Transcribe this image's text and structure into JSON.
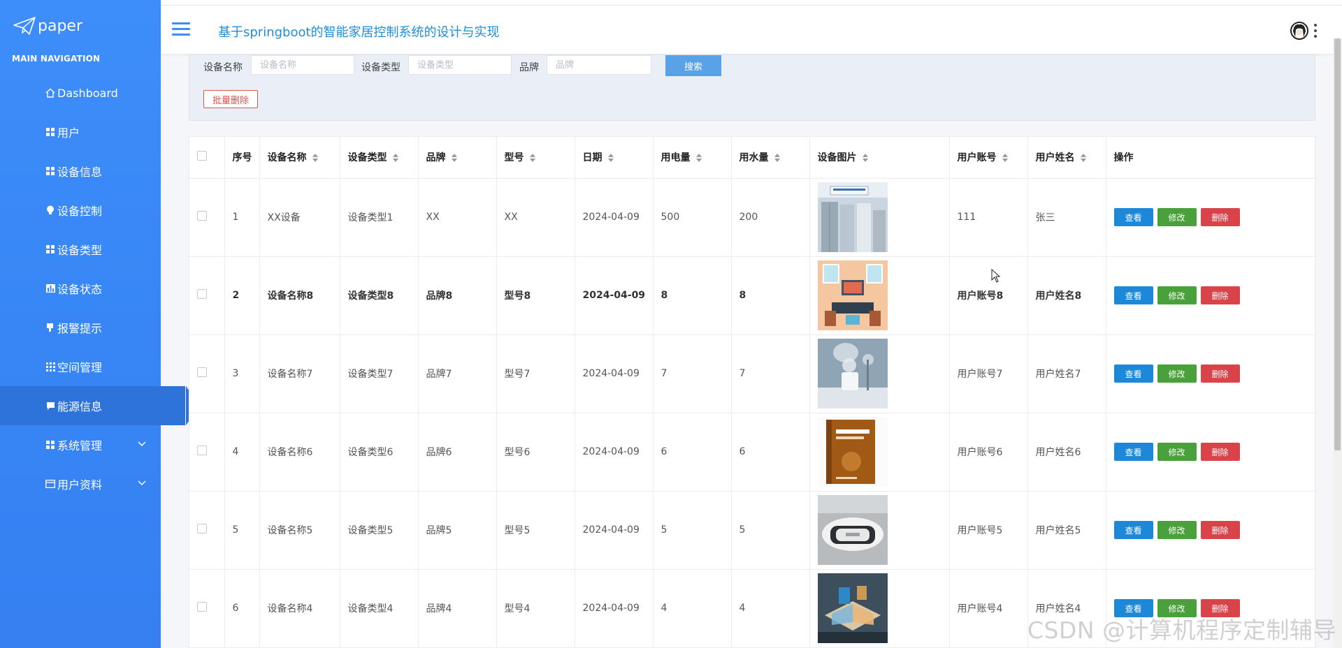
{
  "sidebar": {
    "logo_text": "paper",
    "nav_title": "MAIN NAVIGATION",
    "items": [
      {
        "label": "Dashboard",
        "icon": "home-icon"
      },
      {
        "label": "用户",
        "icon": "grid-icon"
      },
      {
        "label": "设备信息",
        "icon": "grid-icon"
      },
      {
        "label": "设备控制",
        "icon": "bulb-icon"
      },
      {
        "label": "设备类型",
        "icon": "grid-icon"
      },
      {
        "label": "设备状态",
        "icon": "chart-icon"
      },
      {
        "label": "报警提示",
        "icon": "beer-icon"
      },
      {
        "label": "空间管理",
        "icon": "grid9-icon"
      },
      {
        "label": "能源信息",
        "icon": "comment-icon",
        "active": true
      },
      {
        "label": "系统管理",
        "icon": "grid-icon",
        "expandable": true
      },
      {
        "label": "用户资料",
        "icon": "card-icon",
        "expandable": true
      }
    ]
  },
  "header": {
    "title": "基于springboot的智能家居控制系统的设计与实现"
  },
  "search": {
    "name_label": "设备名称",
    "name_placeholder": "设备名称",
    "type_label": "设备类型",
    "type_placeholder": "设备类型",
    "brand_label": "品牌",
    "brand_placeholder": "品牌",
    "search_button": "搜索",
    "batch_delete_button": "批量删除"
  },
  "table": {
    "headers": [
      "序号",
      "设备名称",
      "设备类型",
      "品牌",
      "型号",
      "日期",
      "用电量",
      "用水量",
      "设备图片",
      "用户账号",
      "用户姓名",
      "操作"
    ],
    "rows": [
      {
        "no": "1",
        "name": "XX设备",
        "type": "设备类型1",
        "brand": "XX",
        "model": "XX",
        "date": "2024-04-09",
        "power": "500",
        "water": "200",
        "img": "appliances",
        "account": "111",
        "username": "张三"
      },
      {
        "no": "2",
        "name": "设备名称8",
        "type": "设备类型8",
        "brand": "品牌8",
        "model": "型号8",
        "date": "2024-04-09",
        "power": "8",
        "water": "8",
        "img": "smart-home",
        "account": "用户账号8",
        "username": "用户姓名8"
      },
      {
        "no": "3",
        "name": "设备名称7",
        "type": "设备类型7",
        "brand": "品牌7",
        "model": "型号7",
        "date": "2024-04-09",
        "power": "7",
        "water": "7",
        "img": "humidifier",
        "account": "用户账号7",
        "username": "用户姓名7"
      },
      {
        "no": "4",
        "name": "设备名称6",
        "type": "设备类型6",
        "brand": "品牌6",
        "model": "型号6",
        "date": "2024-04-09",
        "power": "6",
        "water": "6",
        "img": "book",
        "account": "用户账号6",
        "username": "用户姓名6"
      },
      {
        "no": "5",
        "name": "设备名称5",
        "type": "设备类型5",
        "brand": "品牌5",
        "model": "型号5",
        "date": "2024-04-09",
        "power": "5",
        "water": "5",
        "img": "vr-headset",
        "account": "用户账号5",
        "username": "用户姓名5"
      },
      {
        "no": "6",
        "name": "设备名称4",
        "type": "设备类型4",
        "brand": "品牌4",
        "model": "型号4",
        "date": "2024-04-09",
        "power": "4",
        "water": "4",
        "img": "house-model",
        "account": "用户账号4",
        "username": "用户姓名4"
      }
    ],
    "actions": {
      "view": "查看",
      "edit": "修改",
      "delete": "删除"
    }
  },
  "watermark": "CSDN @计算机程序定制辅导",
  "colors": {
    "sidebar": "#3a8af7",
    "accent": "#1e88d8",
    "edit": "#4aa13c",
    "delete": "#d9434a"
  }
}
